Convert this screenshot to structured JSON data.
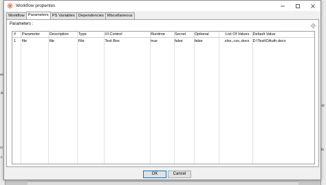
{
  "window": {
    "title": "Workflow properties",
    "minimize_glyph": "—",
    "maximize_glyph": "☐",
    "close_glyph": "✕"
  },
  "tabs": [
    {
      "label": "Workflow",
      "active": false
    },
    {
      "label": "Parameters",
      "active": true
    },
    {
      "label": "PS Variables",
      "active": false
    },
    {
      "label": "Dependencies",
      "active": false
    },
    {
      "label": "Miscellaneous",
      "active": false
    }
  ],
  "panel": {
    "label": "Parameters :",
    "settings_icon": "gear-icon"
  },
  "table": {
    "columns": [
      "#",
      "Parameter",
      "Description",
      "Type",
      "UI Control",
      "Runtime",
      "Secret",
      "Optional",
      "List Of Values",
      "Default Value"
    ],
    "rows": [
      [
        "1",
        "file",
        "file",
        "File",
        "Text Box",
        "true",
        "false",
        "false",
        ".xlsx,.csv,.docx",
        "D:\\Test\\OAuth.docx"
      ]
    ]
  },
  "buttons": {
    "ok": "OK",
    "cancel": "Cancel"
  },
  "background": {
    "frag_left_1": "ec",
    "frag_left_2": "A",
    "frag_left_3": "cr",
    "frag_left_4": "c",
    "frag_right_1": "ect",
    "frag_right_2": "lo"
  },
  "colors": {
    "accent": "#0078d7",
    "app_icon": "#e0603a"
  }
}
